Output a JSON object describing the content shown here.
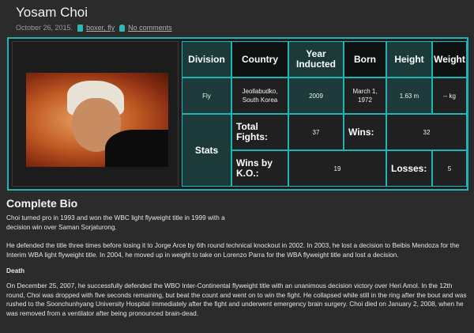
{
  "post": {
    "title": "Yosam Choi",
    "date": "October 26, 2015.",
    "tags": "boxer, fly",
    "comments": "No comments"
  },
  "colors": {
    "accent": "#1fb5b3",
    "background": "#2b2b2b",
    "photo_bg": "#c05a24"
  },
  "icons": {
    "tag": "document-icon",
    "comments": "person-icon"
  },
  "stats_table": {
    "headers": {
      "division": "Division",
      "country": "Country",
      "year_inducted": "Year Inducted",
      "born": "Born",
      "height": "Height",
      "weight": "Weight"
    },
    "values": {
      "division": "Fly",
      "country": "Jeollabudko, South Korea",
      "year_inducted": "2009",
      "born": "March 1, 1972",
      "height": "1.63 m",
      "weight": "-- kg"
    },
    "stats_label": "Stats",
    "total_fights_label": "Total Fights:",
    "total_fights": "37",
    "wins_label": "Wins:",
    "wins": "32",
    "wins_ko_label": "Wins by K.O.:",
    "wins_ko": "19",
    "losses_label": "Losses:",
    "losses": "5"
  },
  "bio": {
    "heading": "Complete Bio",
    "p1": "Choi turned pro in 1993 and won the WBC light flyweight title in 1999 with a decision win over Saman Sorjaturong.",
    "p2": "He defended the title three times before losing it to Jorge Arce by 6th round technical knockout in 2002. In 2003, he lost a decision to Beibis Mendoza for the Interim WBA light flyweight title. In 2004, he moved up in weight to take on Lorenzo Parra for the WBA flyweight title and lost a decision.",
    "death_heading": "Death",
    "p3": "On December 25, 2007, he successfully defended the WBO Inter-Continental flyweight title with an unanimous decision victory over Heri Amol. In the 12th round, Choi was dropped with five seconds remaining, but beat the count and went on to win the fight. He collapsed while still in the ring after the bout and was rushed to the Soonchunhyang University Hospital immediately after the fight and underwent emergency brain surgery. Choi died on January 2, 2008, when he was removed from a ventilator after being pronounced brain-dead."
  }
}
